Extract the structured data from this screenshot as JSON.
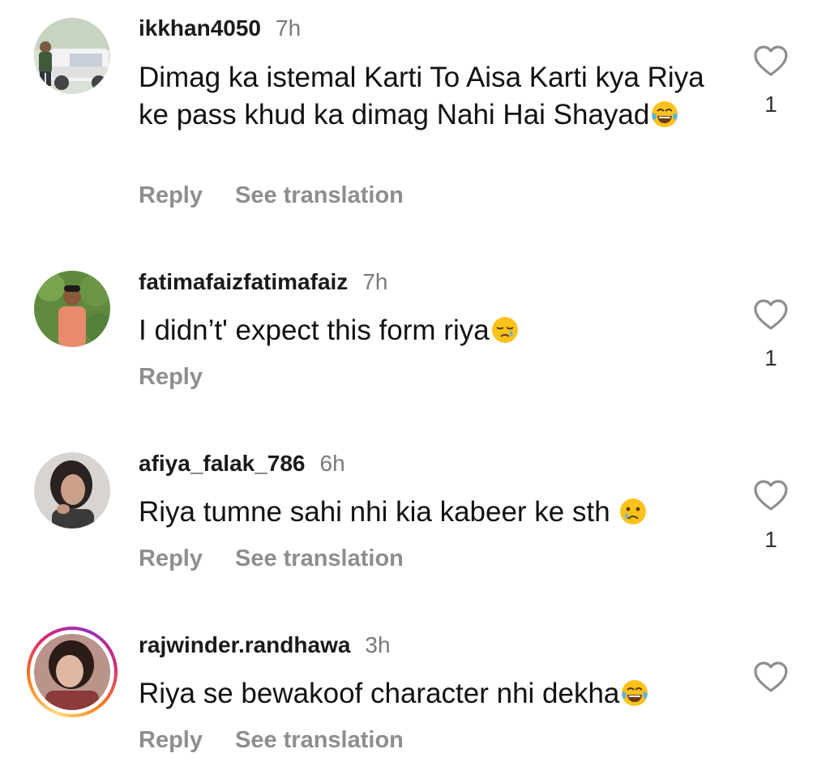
{
  "comments": [
    {
      "username": "ikkhan4050",
      "time": "7h",
      "text": "Dimag ka istemal Karti To Aisa Karti kya Riya ke pass khud ka dimag Nahi Hai Shayad",
      "emoji": "face-with-tears-of-joy-emoji",
      "reply_label": "Reply",
      "translation_label": "See translation",
      "likes": "1"
    },
    {
      "username": "fatimafaizfatimafaiz",
      "time": "7h",
      "text": "I didn’t' expect this form riya",
      "emoji": "sleepy-face-emoji",
      "reply_label": "Reply",
      "likes": "1"
    },
    {
      "username": "afiya_falak_786",
      "time": "6h",
      "text": "Riya tumne sahi nhi kia kabeer ke sth ",
      "emoji": "crying-face-emoji",
      "reply_label": "Reply",
      "translation_label": "See translation",
      "likes": "1"
    },
    {
      "username": "rajwinder.randhawa",
      "time": "3h",
      "text": "Riya se bewakoof character nhi dekha",
      "emoji": "face-with-tears-of-joy-emoji",
      "reply_label": "Reply",
      "translation_label": "See translation"
    }
  ],
  "icons": {
    "like": "heart-outline-icon"
  },
  "colors": {
    "username": "#1a1a1a",
    "meta_gray": "#8e8e8e",
    "story_ring_start": "#feda75",
    "story_ring_end": "#d62976"
  }
}
